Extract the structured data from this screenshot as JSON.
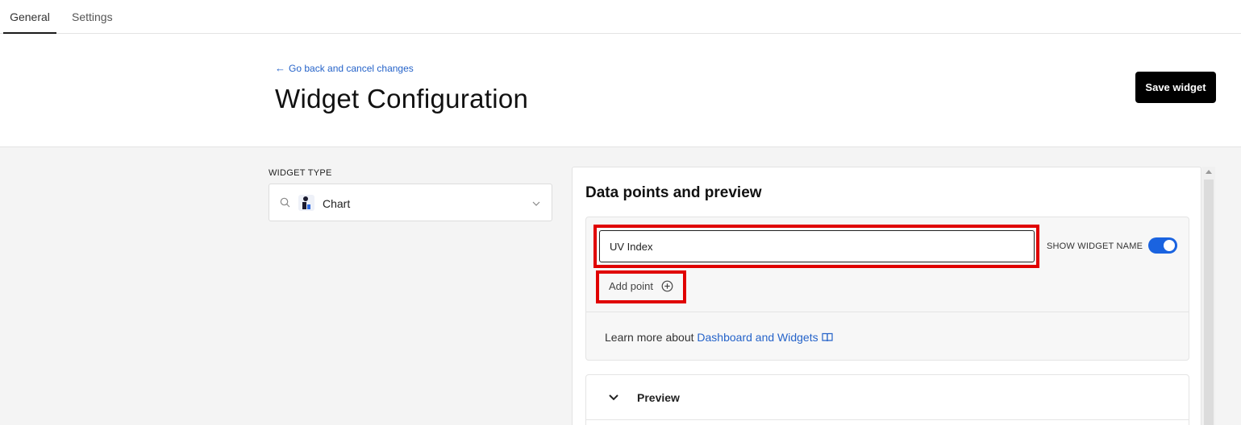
{
  "tabs": [
    {
      "label": "General",
      "active": true
    },
    {
      "label": "Settings",
      "active": false
    }
  ],
  "header": {
    "back_link": "Go back and cancel changes",
    "title": "Widget Configuration",
    "save_label": "Save widget"
  },
  "widget_type": {
    "label": "WIDGET TYPE",
    "value": "Chart",
    "icons": [
      "search-icon",
      "chart-type-icon",
      "chevron-down-icon"
    ]
  },
  "panel": {
    "title": "Data points and preview",
    "name_input_value": "UV Index",
    "show_widget_name_label": "SHOW WIDGET NAME",
    "show_widget_name_on": true,
    "add_point_label": "Add point",
    "learn_prefix": "Learn more about ",
    "learn_link": "Dashboard and Widgets",
    "preview_label": "Preview"
  },
  "colors": {
    "accent": "#2563c9",
    "toggle_on": "#1a63e0",
    "highlight": "#e00000",
    "primary_button": "#000000"
  }
}
